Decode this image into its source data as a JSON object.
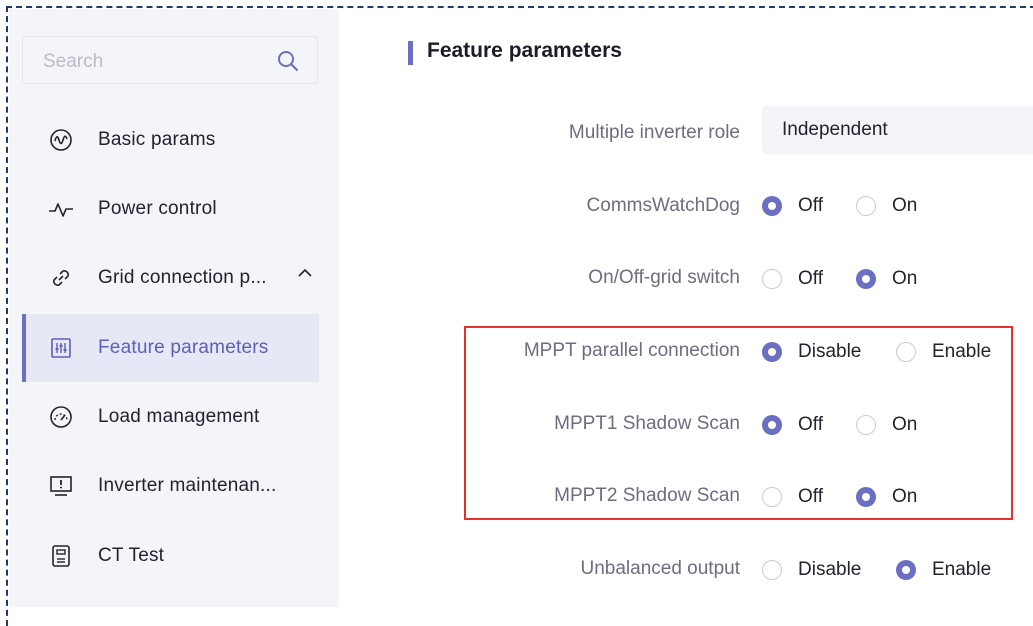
{
  "sidebar": {
    "search_placeholder": "Search",
    "items": [
      {
        "label": "Basic params",
        "icon": "waveform-circle-icon"
      },
      {
        "label": "Power control",
        "icon": "pulse-icon"
      },
      {
        "label": "Grid connection p...",
        "icon": "link-icon"
      },
      {
        "label": "Feature parameters",
        "icon": "sliders-icon"
      },
      {
        "label": "Load management",
        "icon": "gauge-icon"
      },
      {
        "label": "Inverter maintenan...",
        "icon": "monitor-alert-icon"
      },
      {
        "label": "CT Test",
        "icon": "ct-device-icon"
      }
    ]
  },
  "main": {
    "title": "Feature parameters",
    "rows": [
      {
        "label": "Multiple inverter role",
        "type": "select",
        "value": "Independent"
      },
      {
        "label": "CommsWatchDog",
        "type": "radio",
        "options": [
          "Off",
          "On"
        ],
        "selected": "Off"
      },
      {
        "label": "On/Off-grid switch",
        "type": "radio",
        "options": [
          "Off",
          "On"
        ],
        "selected": "On"
      },
      {
        "label": "MPPT parallel connection",
        "type": "radio",
        "options": [
          "Disable",
          "Enable"
        ],
        "selected": "Disable"
      },
      {
        "label": "MPPT1 Shadow Scan",
        "type": "radio",
        "options": [
          "Off",
          "On"
        ],
        "selected": "Off"
      },
      {
        "label": "MPPT2 Shadow Scan",
        "type": "radio",
        "options": [
          "Off",
          "On"
        ],
        "selected": "On"
      },
      {
        "label": "Unbalanced output",
        "type": "radio",
        "options": [
          "Disable",
          "Enable"
        ],
        "selected": "Enable"
      }
    ]
  },
  "colors": {
    "accent": "#6b6fc2",
    "highlight_border": "#e5302c",
    "sidebar_bg": "#f4f5f8"
  }
}
